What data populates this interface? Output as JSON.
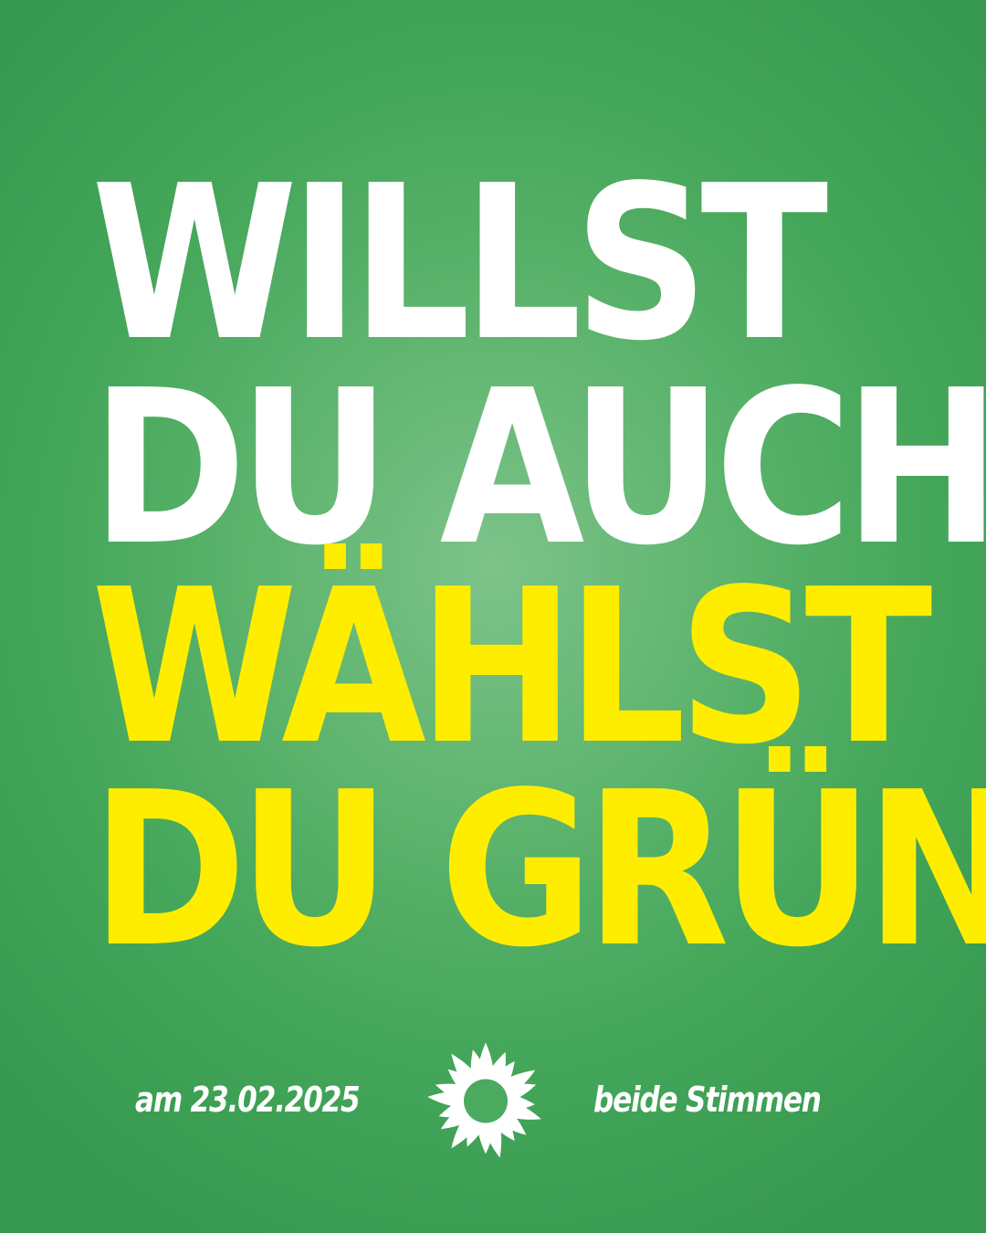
{
  "headline": {
    "line1": "WILLST",
    "line2": "DU AUCH?",
    "line3": "WÄHLST",
    "line4": "DU GRÜN!"
  },
  "footer": {
    "date": "am 23.02.2025",
    "note": "beide Stimmen",
    "logo_icon": "sunflower-icon"
  },
  "colors": {
    "background": "#4aaa5f",
    "primary_text": "#ffffff",
    "accent_text": "#ffed00"
  }
}
